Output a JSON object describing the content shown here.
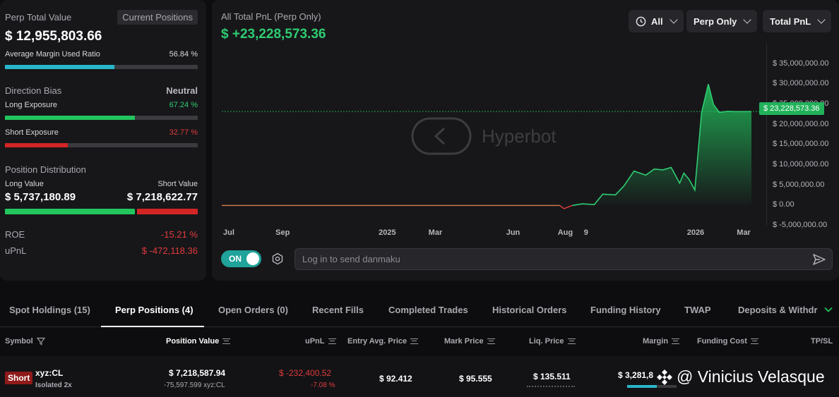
{
  "summary": {
    "perp_total_value_label": "Perp Total Value",
    "current_positions_button": "Current Positions",
    "perp_total_value": "$ 12,955,803.66",
    "avg_margin_label": "Average Margin Used Ratio",
    "avg_margin_value": "56.84 %",
    "avg_margin_fraction": 0.5684,
    "direction_bias_label": "Direction Bias",
    "direction_bias_value": "Neutral",
    "long_exposure_label": "Long Exposure",
    "long_exposure_value": "67.24 %",
    "long_exposure_fraction": 0.6724,
    "short_exposure_label": "Short Exposure",
    "short_exposure_value": "32.77 %",
    "short_exposure_fraction": 0.3277,
    "position_distribution_label": "Position Distribution",
    "long_value_label": "Long Value",
    "short_value_label": "Short Value",
    "long_value": "$ 5,737,180.89",
    "short_value": "$ 7,218,622.77",
    "roe_label": "ROE",
    "roe_value": "-15.21 %",
    "upnl_label": "uPnL",
    "upnl_value": "$ -472,118.36"
  },
  "chart_header": {
    "title": "All Total PnL (Perp Only)",
    "value": "$ +23,228,573.36",
    "filter_time": "All",
    "filter_scope": "Perp Only",
    "filter_metric": "Total PnL",
    "watermark": "Hyperbot",
    "current_price_tag": "$ 23,228,573.36"
  },
  "chart_data": {
    "type": "area",
    "x_ticks": [
      "Jul",
      "Sep",
      "2025",
      "Mar",
      "Jun",
      "Aug",
      "9",
      "2026",
      "Mar"
    ],
    "y_ticks": [
      "$ 35,000,000.00",
      "$ 30,000,000.00",
      "$ 25,000,000.00",
      "$ 20,000,000.00",
      "$ 15,000,000.00",
      "$ 10,000,000.00",
      "$ 5,000,000.00",
      "$ 0.00",
      "$ -5,000,000.00"
    ],
    "ylim": [
      -5000000,
      40000000
    ],
    "x": [
      "2024-07-01",
      "2025-07-25",
      "2025-08-01",
      "2025-08-05",
      "2025-08-10",
      "2025-08-20",
      "2025-09-01",
      "2025-09-15",
      "2025-09-25",
      "2025-10-10",
      "2025-10-20",
      "2025-11-01",
      "2025-11-15",
      "2025-11-25",
      "2025-12-05",
      "2025-12-15",
      "2025-12-25",
      "2025-12-30",
      "2026-01-05",
      "2026-01-12",
      "2026-01-20",
      "2026-01-28",
      "2026-02-03",
      "2026-02-10",
      "2026-02-20",
      "2026-03-01",
      "2026-03-20"
    ],
    "values": [
      0,
      0,
      0,
      0,
      -800000,
      0,
      400000,
      200000,
      2800000,
      2600000,
      4800000,
      8500000,
      7500000,
      9000000,
      8800000,
      9400000,
      5500000,
      8000000,
      6500000,
      3800000,
      23000000,
      30000000,
      25000000,
      23000000,
      23300000,
      23200000,
      23228573
    ],
    "grid": false
  },
  "danmaku": {
    "toggle_label": "ON",
    "placeholder": "Log in to send danmaku"
  },
  "tabs": [
    "Spot Holdings (15)",
    "Perp Positions (4)",
    "Open Orders (0)",
    "Recent Fills",
    "Completed Trades",
    "Historical Orders",
    "Funding History",
    "TWAP",
    "Deposits & Withdra"
  ],
  "table": {
    "headers": {
      "symbol": "Symbol",
      "position_value": "Position Value",
      "upnl": "uPnL",
      "entry": "Entry Avg. Price",
      "mark": "Mark Price",
      "liq": "Liq. Price",
      "margin": "Margin",
      "funding": "Funding Cost",
      "tpsl": "TP/SL"
    },
    "row": {
      "side": "Short",
      "symbol": "xyz:CL",
      "margin_mode": "Isolated 2x",
      "position_value": "$ 7,218,587.94",
      "size": "-75,597.599 xyz:CL",
      "upnl": "$ -232,400.52",
      "upnl_pct": "-7.08 %",
      "entry": "$ 92.412",
      "mark": "$ 95.555",
      "liq": "$ 135.511",
      "margin": "$ 3,281,8",
      "margin_fill_fraction": 0.6
    }
  },
  "overlay_watermark": "@ Vinicius Velasque"
}
